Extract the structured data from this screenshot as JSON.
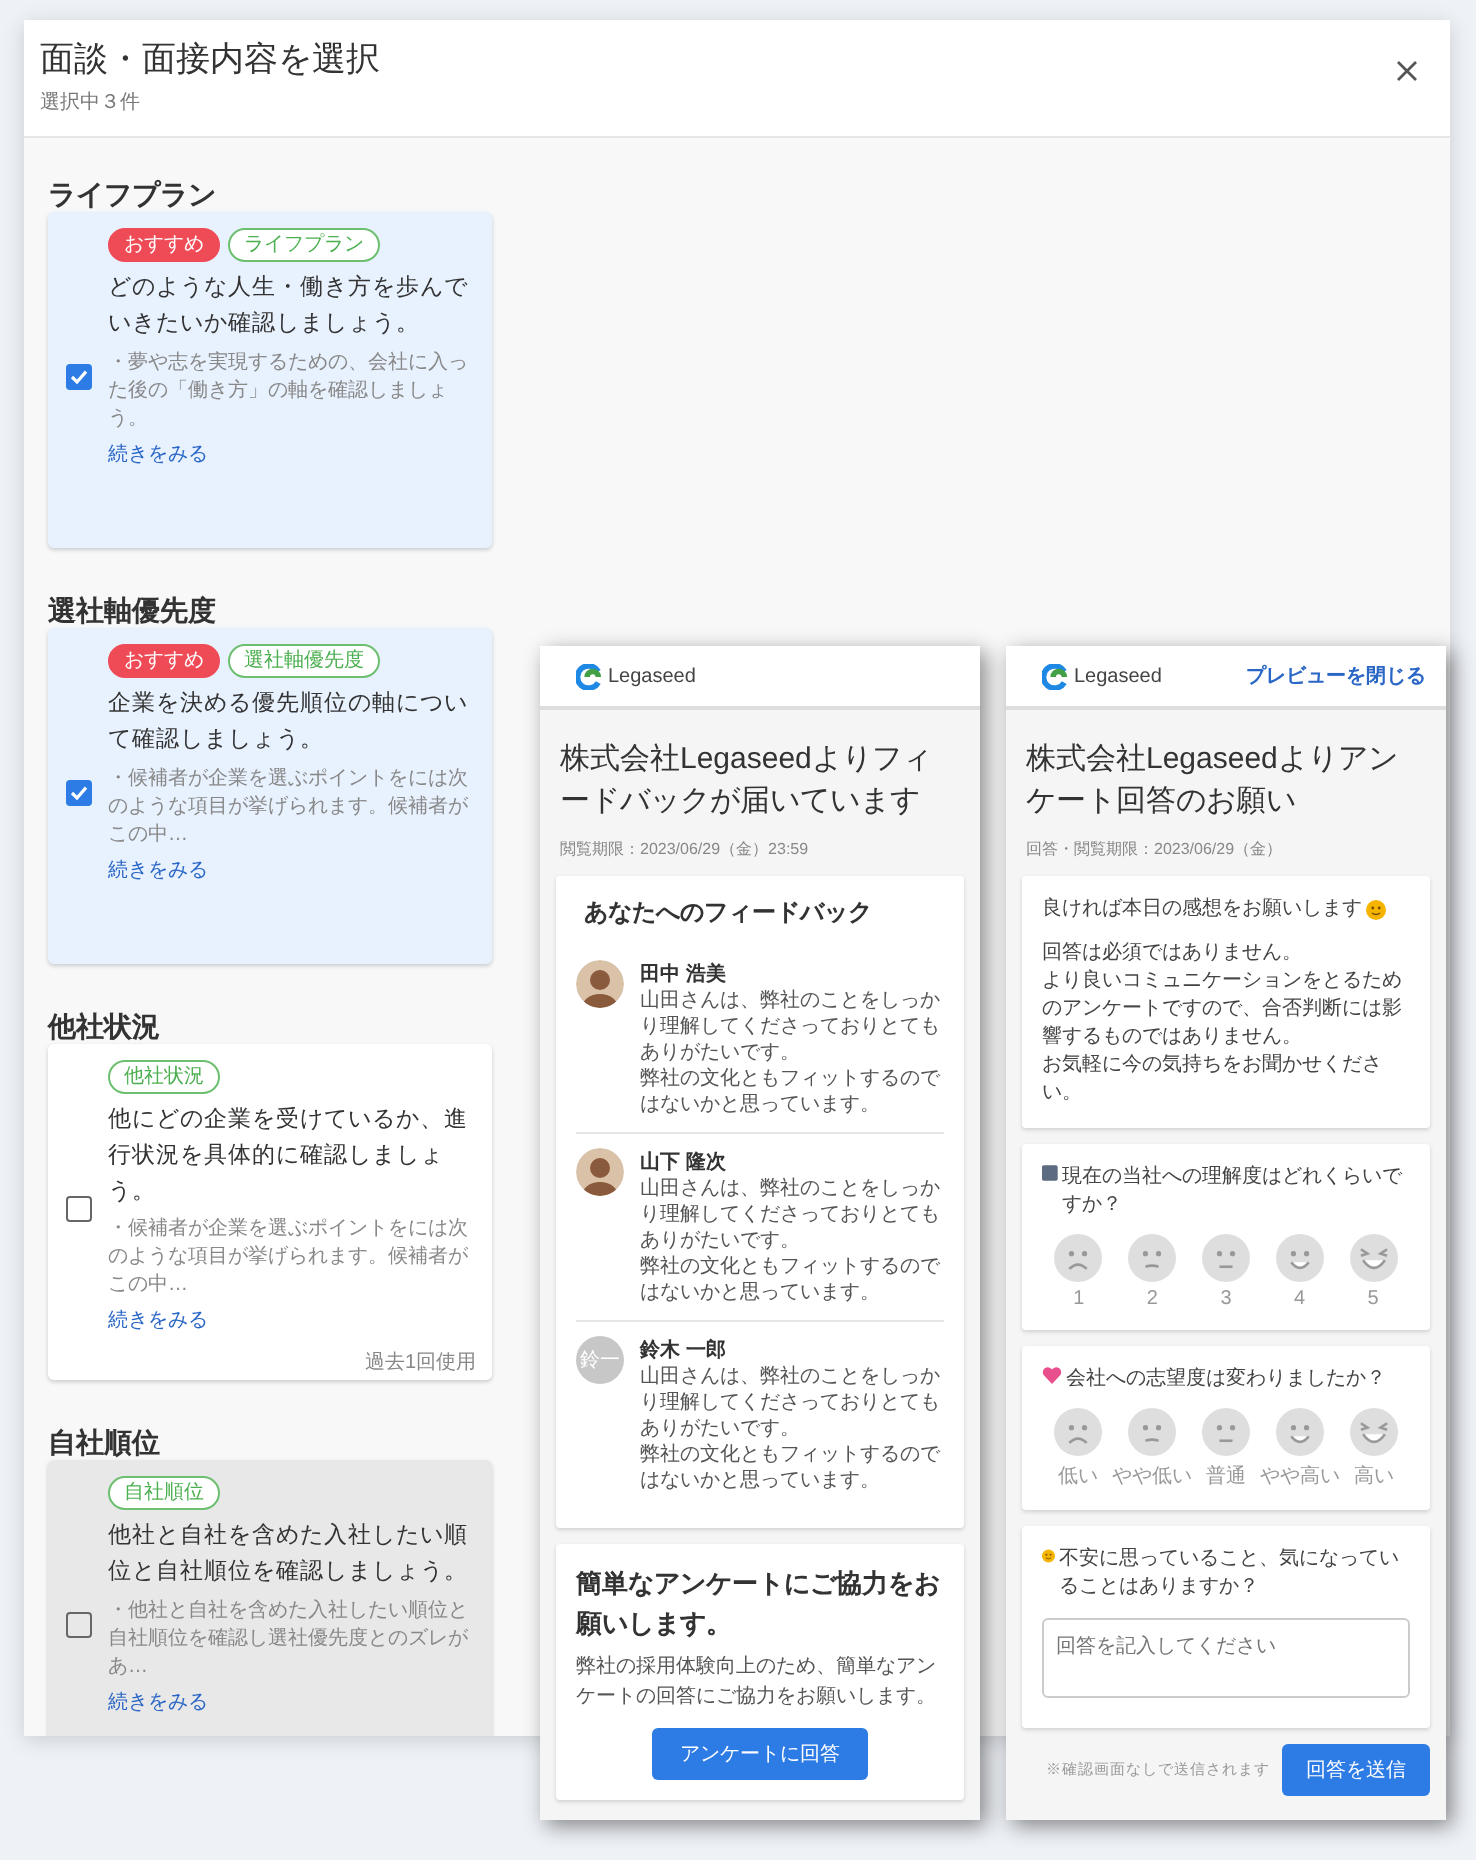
{
  "dialog": {
    "title": "面談・面接内容を選択",
    "subtitle": "選択中３件"
  },
  "sections": [
    {
      "heading": "ライフプラン",
      "card": {
        "tags": [
          {
            "label": "おすすめ",
            "kind": "recommended"
          },
          {
            "label": "ライフプラン",
            "kind": "category"
          }
        ],
        "title": "どのような人生・働き方を歩んでいきたいか確認しましょう。",
        "description": "・夢や志を実現するための、会社に入った後の「働き方」の軸を確認しましょう。",
        "link": "続きをみる",
        "checked": true,
        "disabled": false
      }
    },
    {
      "heading": "選社軸優先度",
      "card": {
        "tags": [
          {
            "label": "おすすめ",
            "kind": "recommended"
          },
          {
            "label": "選社軸優先度",
            "kind": "category"
          }
        ],
        "title": "企業を決める優先順位の軸について確認しましょう。",
        "description": "・候補者が企業を選ぶポイントをには次のような項目が挙げられます。候補者がこの中…",
        "link": "続きをみる",
        "checked": true,
        "disabled": false
      }
    },
    {
      "heading": "他社状況",
      "card": {
        "tags": [
          {
            "label": "他社状況",
            "kind": "category"
          }
        ],
        "title": "他にどの企業を受けているか、進行状況を具体的に確認しましょう。",
        "description": "・候補者が企業を選ぶポイントをには次のような項目が挙げられます。候補者がこの中…",
        "link": "続きをみる",
        "usage": "過去1回使用",
        "checked": false,
        "disabled": false
      }
    },
    {
      "heading": "自社順位",
      "card": {
        "tags": [
          {
            "label": "自社順位",
            "kind": "category"
          }
        ],
        "title": "他社と自社を含めた入社したい順位と自社順位を確認しましょう。",
        "description": "・他社と自社を含めた入社したい順位と自社順位を確認し選社優先度とのズレがあ…",
        "link": "続きをみる",
        "checked": false,
        "disabled": true
      }
    }
  ],
  "feedback_preview": {
    "logo": "Legaseed",
    "title": "株式会社Legaseedよりフィードバックが届いています",
    "deadline": "閲覧期限：2023/06/29（金）23:59",
    "feedback_heading": "あなたへのフィードバック",
    "feedbacks": [
      {
        "name": "田中 浩美",
        "message": [
          "山田さんは、弊社のことをしっかり理解してくださっておりとてもありがたいです。",
          "弊社の文化ともフィットするのではないかと思っています。"
        ],
        "avatar": {
          "kind": "photo"
        }
      },
      {
        "name": "山下 隆次",
        "message": [
          "山田さんは、弊社のことをしっかり理解してくださっておりとてもありがたいです。",
          "弊社の文化ともフィットするのではないかと思っています。"
        ],
        "avatar": {
          "kind": "photo"
        }
      },
      {
        "name": "鈴木 一郎",
        "message": [
          "山田さんは、弊社のことをしっかり理解してくださっておりとてもありがたいです。",
          "弊社の文化ともフィットするのではないかと思っています。"
        ],
        "avatar": {
          "kind": "initials",
          "initials": "鈴一"
        }
      }
    ],
    "survey_card": {
      "heading": "簡単なアンケートにご協力をお願いします。",
      "text": "弊社の採用体験向上のため、簡単なアンケートの回答にご協力をお願いします。",
      "button": "アンケートに回答"
    }
  },
  "survey_preview": {
    "logo": "Legaseed",
    "close_link": "プレビューを閉じる",
    "title": "株式会社Legaseedよりアンケート回答のお願い",
    "deadline": "回答・閲覧期限：2023/06/29（金）",
    "intro_lead": "良ければ本日の感想をお願いします",
    "intro_text": [
      "回答は必須ではありません。",
      "より良いコミュニケーションをとるためのアンケートですので、合否判断には影響するものではありません。",
      "お気軽に今の気持ちをお聞かせください。"
    ],
    "questions": [
      {
        "kind": "rating",
        "text": "現在の当社への理解度はどれくらいですか？",
        "options": [
          "1",
          "2",
          "3",
          "4",
          "5"
        ]
      },
      {
        "kind": "rating",
        "text": "会社への志望度は変わりましたか？",
        "options": [
          "低い",
          "やや低い",
          "普通",
          "やや高い",
          "高い"
        ]
      },
      {
        "kind": "text",
        "text": "不安に思っていること、気になっていることはありますか？",
        "placeholder": "回答を記入してください"
      }
    ],
    "footer_note": "※確認画面なしで送信されます",
    "submit": "回答を送信"
  }
}
